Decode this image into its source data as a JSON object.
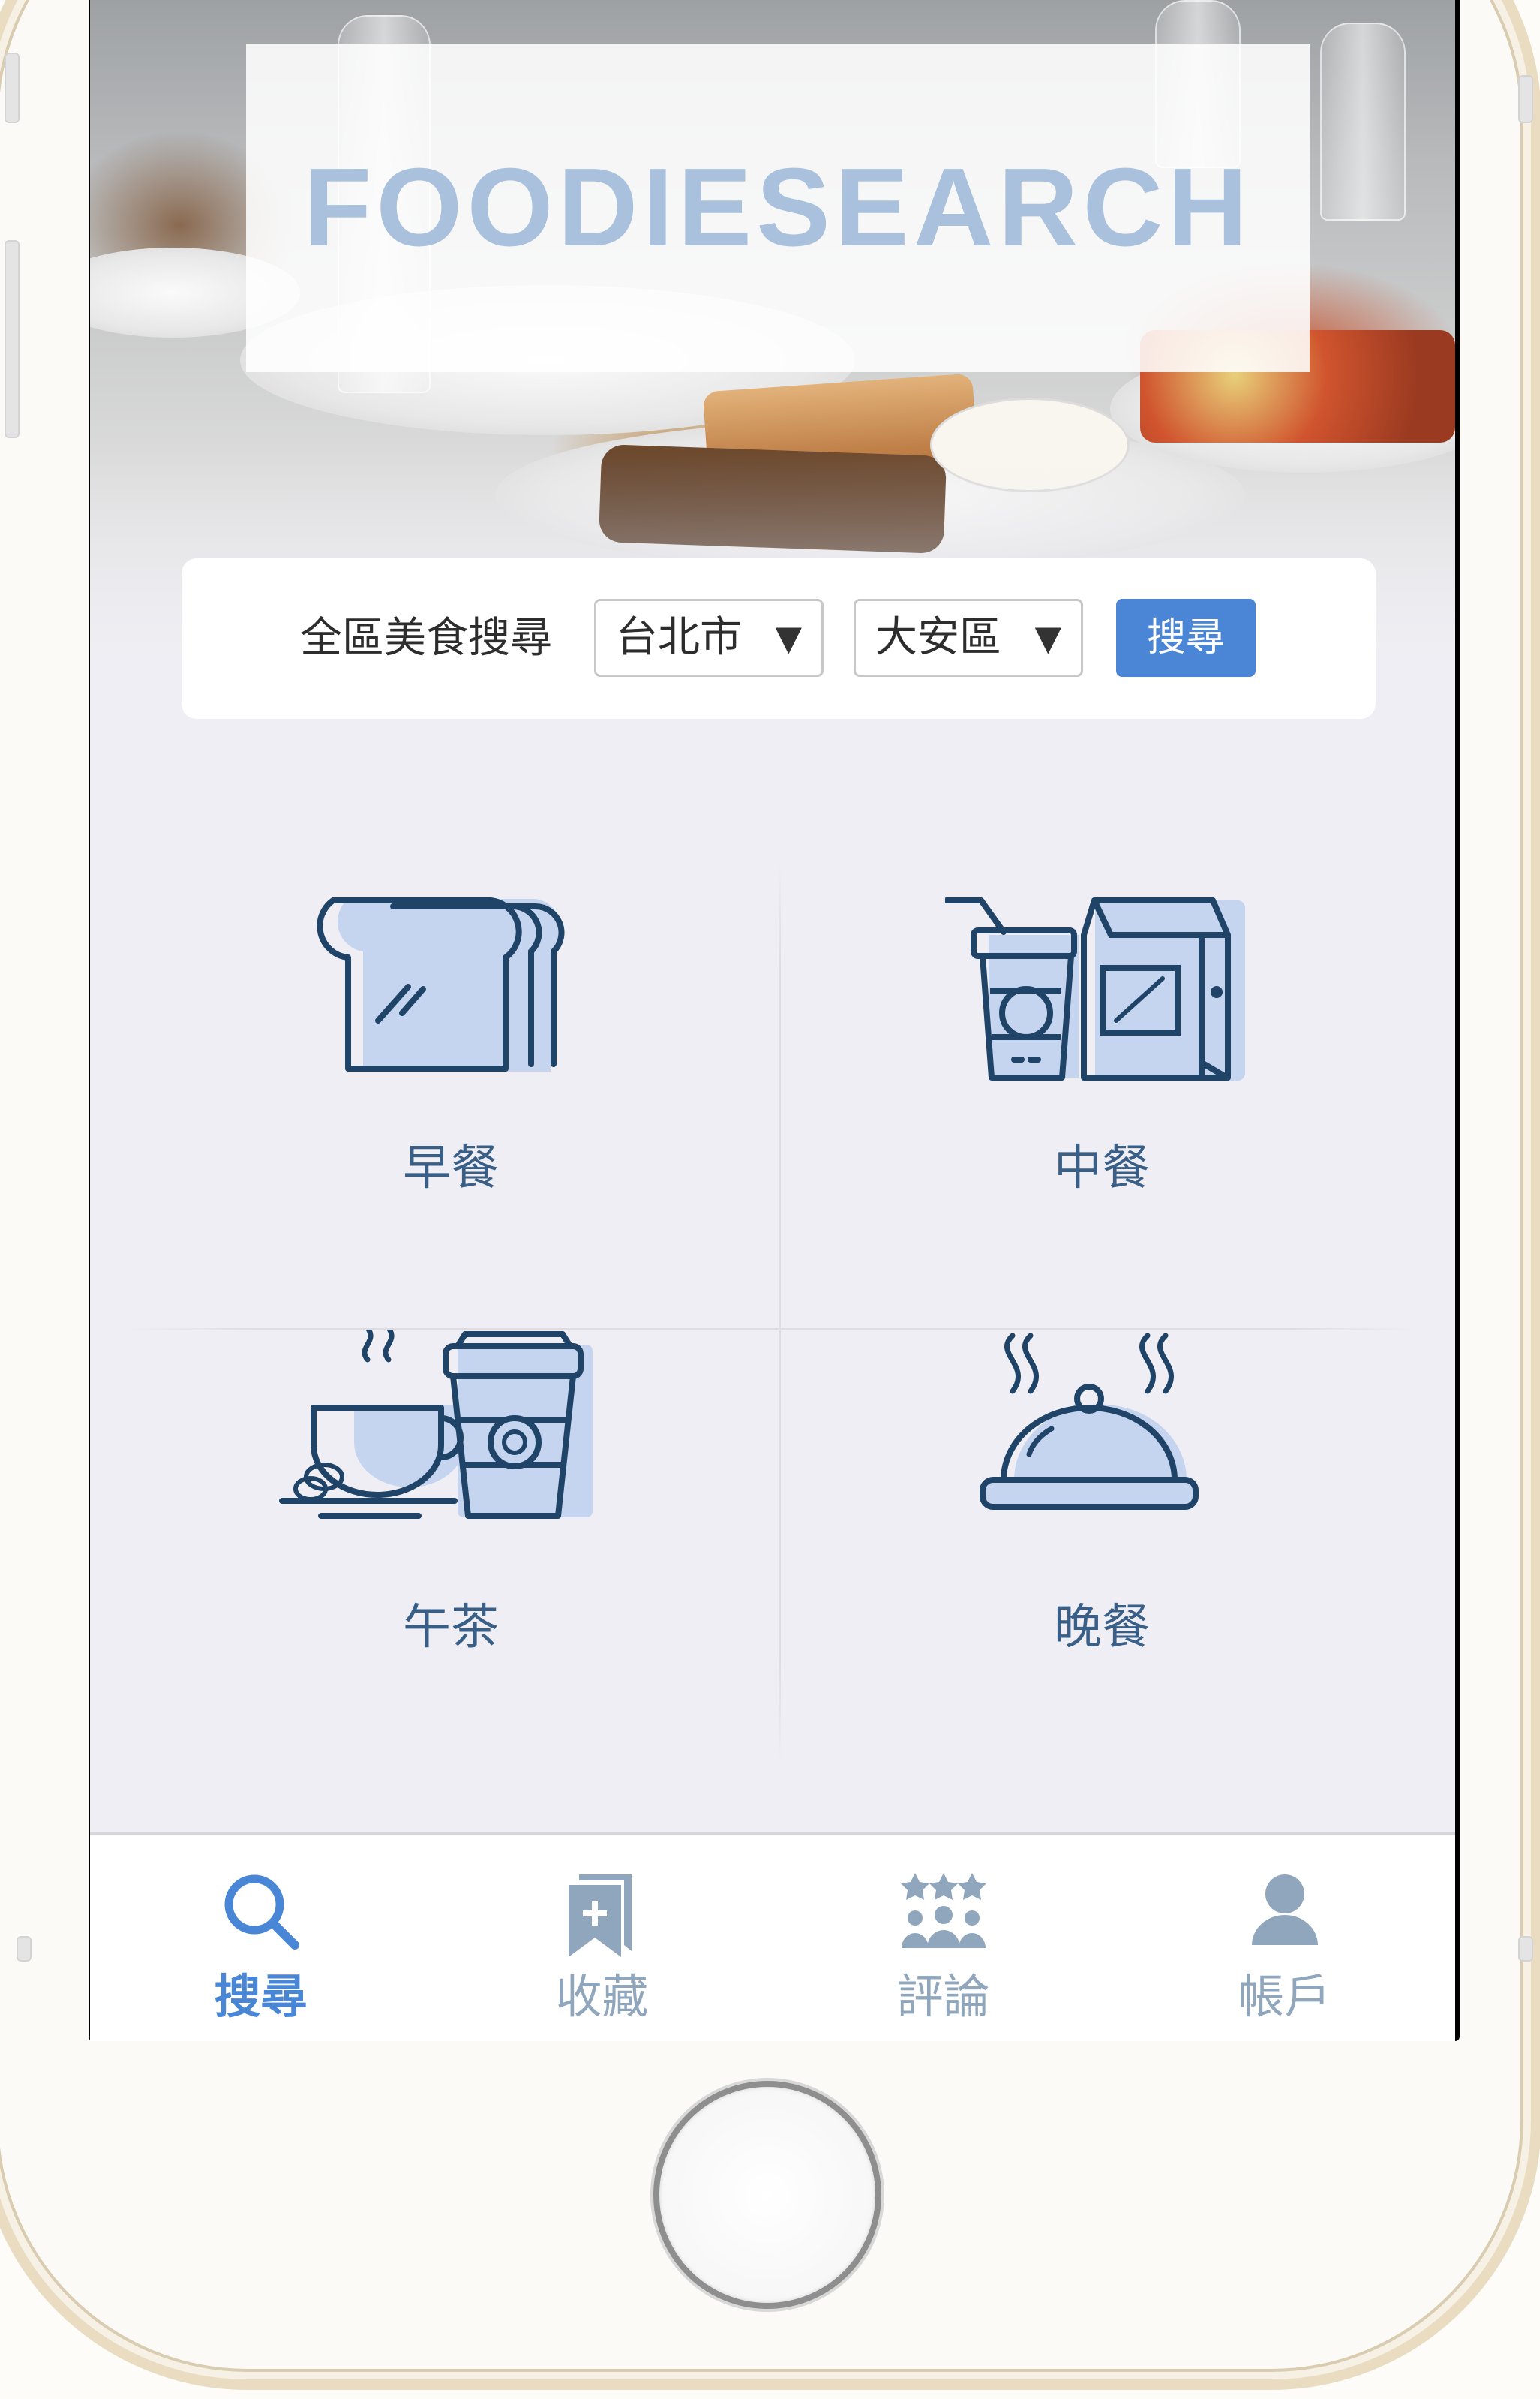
{
  "app": {
    "logo_text": "FOODIESEARCH"
  },
  "search_bar": {
    "title": "全區美食搜尋",
    "city": "台北市",
    "district": "大安區",
    "caret": "▼",
    "button_label": "搜尋"
  },
  "categories": [
    {
      "label": "早餐",
      "icon": "toast-bread-icon"
    },
    {
      "label": "中餐",
      "icon": "takeaway-meal-icon"
    },
    {
      "label": "午茶",
      "icon": "coffee-tea-icon"
    },
    {
      "label": "晚餐",
      "icon": "serving-cloche-icon"
    }
  ],
  "tab_bar": {
    "active": "search",
    "tabs": [
      {
        "label": "搜尋",
        "icon": "search-icon"
      },
      {
        "label": "收藏",
        "icon": "bookmark-icon"
      },
      {
        "label": "評論",
        "icon": "reviews-icon"
      },
      {
        "label": "帳戶",
        "icon": "account-icon"
      }
    ]
  },
  "colors": {
    "accent": "#4b86d6",
    "icon_stroke": "#1f4468",
    "icon_fill": "#c5d4ef",
    "logo": "#a9c1dc",
    "label": "#3a5f86",
    "inactive_tab": "#8fa6bd"
  }
}
